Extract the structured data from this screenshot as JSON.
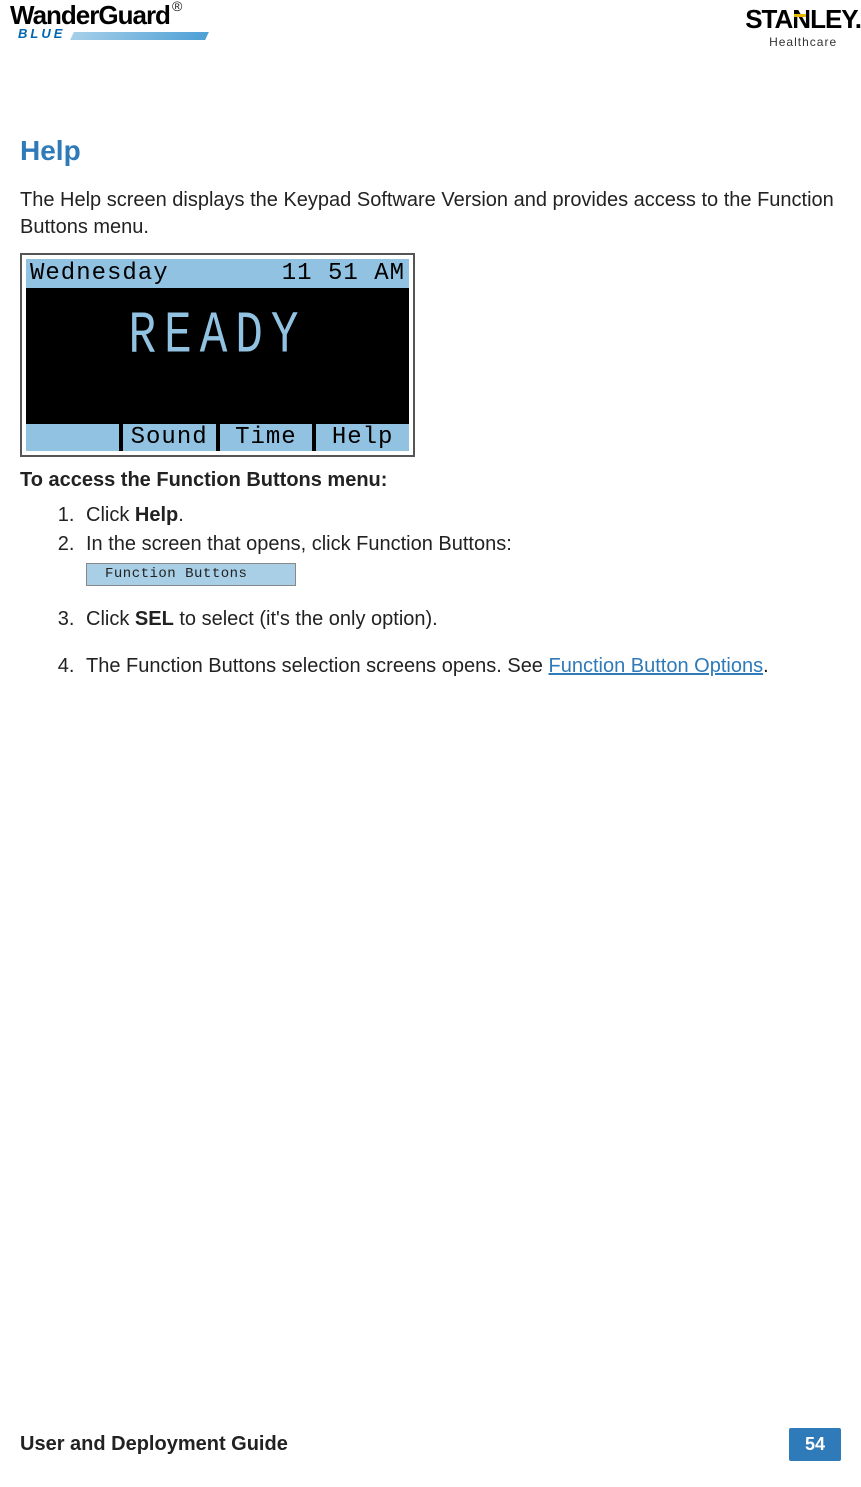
{
  "header": {
    "logo_left_name": "WanderGuard",
    "logo_left_reg": "®",
    "logo_left_sub": "BLUE",
    "logo_right_name_a": "STA",
    "logo_right_name_b": "N",
    "logo_right_name_c": "LEY",
    "logo_right_sub": "Healthcare"
  },
  "section": {
    "title": "Help",
    "intro": "The Help screen displays the Keypad Software Version and provides access to the Function Buttons menu."
  },
  "keypad": {
    "day": "Wednesday",
    "time": "11 51 AM",
    "status": "READY",
    "btns": [
      "",
      "Sound",
      "Time",
      "Help"
    ]
  },
  "instructions": {
    "heading": "To access the Function Buttons menu:",
    "step1_a": "Click ",
    "step1_b": "Help",
    "step1_c": ".",
    "step2": "In the screen that opens, click Function Buttons:",
    "badge": "Function Buttons",
    "step3_a": "Click ",
    "step3_b": "SEL",
    "step3_c": " to select (it's the only option).",
    "step4_a": "The Function Buttons selection screens opens. See ",
    "step4_link": "Function Button Options",
    "step4_c": "."
  },
  "footer": {
    "title": "User and Deployment Guide",
    "page": "54"
  }
}
